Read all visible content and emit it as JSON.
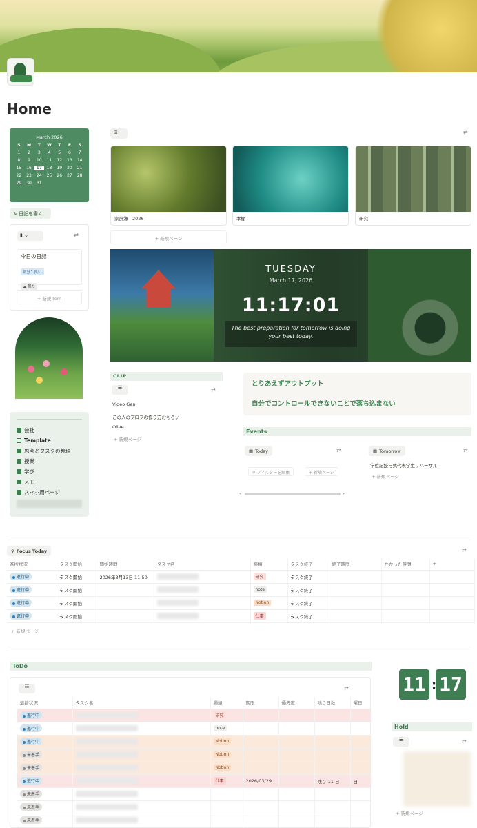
{
  "page": {
    "title": "Home"
  },
  "calendar": {
    "month": "March 2026",
    "dow": [
      "S",
      "M",
      "T",
      "W",
      "T",
      "F",
      "S"
    ],
    "days": [
      "1",
      "2",
      "3",
      "4",
      "5",
      "6",
      "7",
      "8",
      "9",
      "10",
      "11",
      "12",
      "13",
      "14",
      "15",
      "16",
      "17",
      "18",
      "19",
      "20",
      "21",
      "22",
      "23",
      "24",
      "25",
      "26",
      "27",
      "28",
      "29",
      "30",
      "31"
    ],
    "today": "17"
  },
  "diary": {
    "write_button": "日記を書く",
    "card_title": "今日の日記",
    "mood_tag": "気分：良い",
    "weather_tag": "曇り",
    "new_item": "+ 新規item"
  },
  "menu": {
    "items": [
      "会社",
      "Template",
      "思考とタスクの整理",
      "授業",
      "学び",
      "メモ",
      "スマホ用ページ"
    ]
  },
  "gallery": {
    "cards": [
      "家計簿 - 2026 -",
      "本棚",
      "研究"
    ],
    "new_page": "+ 新規ページ"
  },
  "clock_widget": {
    "day": "TUESDAY",
    "date": "March 17, 2026",
    "time": "11:17:01",
    "quote": "The best preparation for tomorrow is doing your best today."
  },
  "clip": {
    "header": "CLIP",
    "items": [
      "Video Gen",
      "この人のプロフの作り方おもろい",
      "Olive"
    ],
    "new_page": "+ 新規ページ"
  },
  "affirmations": [
    "とりあえずアウトプット",
    "自分でコントロールできないことで落ち込まない"
  ],
  "events": {
    "header": "Events",
    "today_tab": "Today",
    "tomorrow_tab": "Tomorrow",
    "filter_button": "フィルターを編集",
    "new_page": "+ 新規ページ",
    "tomorrow_items": [
      "学位記授与式代表学生リハーサル"
    ]
  },
  "focus_today": {
    "title": "Focus Today",
    "columns": [
      "進捗状況",
      "タスク開始",
      "開始時間",
      "タスク名",
      "種類",
      "タスク終了",
      "終了時間",
      "かかった時間",
      "+"
    ],
    "rows": [
      {
        "status": "進行中",
        "start": "タスク開始",
        "start_time": "2026年3月13日 11:50",
        "type": "研究",
        "end": "タスク終了"
      },
      {
        "status": "進行中",
        "start": "タスク開始",
        "start_time": "",
        "type": "note",
        "end": "タスク終了"
      },
      {
        "status": "進行中",
        "start": "タスク開始",
        "start_time": "",
        "type": "Notion",
        "end": "タスク終了"
      },
      {
        "status": "進行中",
        "start": "タスク開始",
        "start_time": "",
        "type": "仕事",
        "end": "タスク終了"
      }
    ],
    "new_page": "+ 新規ページ"
  },
  "todo": {
    "header": "ToDo",
    "columns": [
      "進捗状況",
      "タスク名",
      "種類",
      "期限",
      "優先度",
      "残り日数",
      "曜日"
    ],
    "rows": [
      {
        "status": "進行中",
        "type": "研究",
        "due": "",
        "remaining": "",
        "weekday": ""
      },
      {
        "status": "進行中",
        "type": "note",
        "due": "",
        "remaining": "",
        "weekday": ""
      },
      {
        "status": "進行中",
        "type": "Notion",
        "due": "",
        "remaining": "",
        "weekday": ""
      },
      {
        "status": "未着手",
        "type": "Notion",
        "due": "",
        "remaining": "",
        "weekday": ""
      },
      {
        "status": "未着手",
        "type": "Notion",
        "due": "",
        "remaining": "",
        "weekday": ""
      },
      {
        "status": "進行中",
        "type": "仕事",
        "due": "2026/03/29",
        "remaining": "残り 11 日",
        "weekday": "日"
      },
      {
        "status": "未着手",
        "type": "",
        "due": "",
        "remaining": "",
        "weekday": ""
      },
      {
        "status": "未着手",
        "type": "",
        "due": "",
        "remaining": "",
        "weekday": ""
      },
      {
        "status": "未着手",
        "type": "",
        "due": "",
        "remaining": "",
        "weekday": ""
      }
    ]
  },
  "flip_clock": {
    "hour": "11",
    "minute": "17"
  },
  "hold": {
    "header": "Hold",
    "new_page": "+ 新規ページ"
  },
  "colors": {
    "accent": "#4e8a62",
    "header_bg": "#eaf1ea",
    "accent_text": "#3f8a54"
  }
}
